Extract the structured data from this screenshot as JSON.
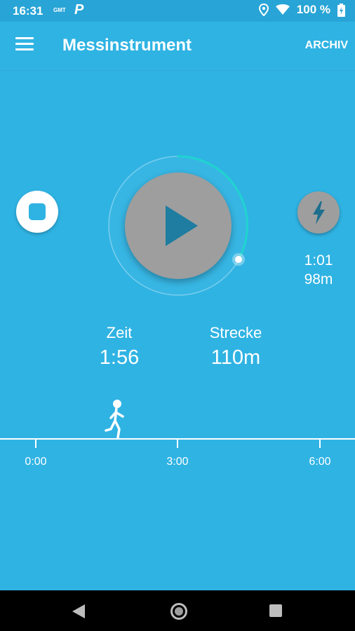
{
  "status_bar": {
    "time": "16:31",
    "small_text": "GMT",
    "p_icon": "P",
    "battery": "100 %"
  },
  "app_bar": {
    "title": "Messinstrument",
    "archive_label": "ARCHIV"
  },
  "current_lap": {
    "time": "1:01",
    "distance": "98m"
  },
  "stats": {
    "time_label": "Zeit",
    "time_value": "1:56",
    "distance_label": "Strecke",
    "distance_value": "110m"
  },
  "timeline": {
    "ticks": [
      "0:00",
      "3:00",
      "6:00"
    ]
  },
  "colors": {
    "background": "#2fb3e3",
    "accent_ring": "#20d4d0",
    "button_gray": "#9e9e9e",
    "play_icon": "#1e7da0"
  },
  "icons": [
    "menu-icon",
    "stop-icon",
    "play-icon",
    "lightning-icon",
    "runner-icon",
    "location-icon",
    "wifi-icon",
    "battery-icon"
  ]
}
